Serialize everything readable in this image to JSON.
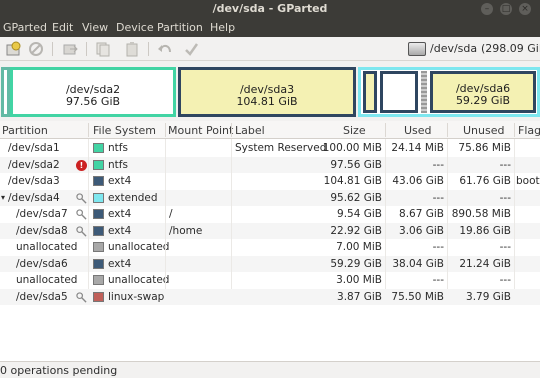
{
  "window": {
    "title": "/dev/sda - GParted"
  },
  "menu": [
    "GParted",
    "Edit",
    "View",
    "Device",
    "Partition",
    "Help"
  ],
  "toolbar": {
    "icons": [
      "new-icon",
      "delete-icon",
      "resize-icon",
      "copy-icon",
      "paste-icon",
      "undo-icon",
      "apply-icon"
    ]
  },
  "device": {
    "name": "/dev/sda",
    "size": "(298.09 GiB)"
  },
  "graph": {
    "sda2": {
      "name": "/dev/sda2",
      "size": "97.56 GiB"
    },
    "sda3": {
      "name": "/dev/sda3",
      "size": "104.81 GiB"
    },
    "sda6": {
      "name": "/dev/sda6",
      "size": "59.29 GiB"
    }
  },
  "columns": {
    "partition": "Partition",
    "filesystem": "File System",
    "mount": "Mount Point",
    "label": "Label",
    "size": "Size",
    "used": "Used",
    "unused": "Unused",
    "flags": "Flag"
  },
  "rows": [
    {
      "partition": "/dev/sda1",
      "fs": "ntfs",
      "fs_color": "#42d4a4",
      "mount": "",
      "label": "System Reserved",
      "size": "100.00 MiB",
      "used": "24.14 MiB",
      "unused": "75.86 MiB",
      "flags": "",
      "icon": ""
    },
    {
      "partition": "/dev/sda2",
      "fs": "ntfs",
      "fs_color": "#42d4a4",
      "mount": "",
      "label": "",
      "size": "97.56 GiB",
      "used": "---",
      "unused": "---",
      "flags": "",
      "icon": "warning"
    },
    {
      "partition": "/dev/sda3",
      "fs": "ext4",
      "fs_color": "#3d5a78",
      "mount": "",
      "label": "",
      "size": "104.81 GiB",
      "used": "43.06 GiB",
      "unused": "61.76 GiB",
      "flags": "boot",
      "icon": ""
    },
    {
      "partition": "/dev/sda4",
      "fs": "extended",
      "fs_color": "#7ee7ef",
      "mount": "",
      "label": "",
      "size": "95.62 GiB",
      "used": "---",
      "unused": "---",
      "flags": "",
      "icon": "key"
    },
    {
      "partition": "/dev/sda7",
      "fs": "ext4",
      "fs_color": "#3d5a78",
      "mount": "/",
      "label": "",
      "size": "9.54 GiB",
      "used": "8.67 GiB",
      "unused": "890.58 MiB",
      "flags": "",
      "icon": "key"
    },
    {
      "partition": "/dev/sda8",
      "fs": "ext4",
      "fs_color": "#3d5a78",
      "mount": "/home",
      "label": "",
      "size": "22.92 GiB",
      "used": "3.06 GiB",
      "unused": "19.86 GiB",
      "flags": "",
      "icon": "key"
    },
    {
      "partition": "unallocated",
      "fs": "unallocated",
      "fs_color": "#a8a8a8",
      "mount": "",
      "label": "",
      "size": "7.00 MiB",
      "used": "---",
      "unused": "---",
      "flags": "",
      "icon": ""
    },
    {
      "partition": "/dev/sda6",
      "fs": "ext4",
      "fs_color": "#3d5a78",
      "mount": "",
      "label": "",
      "size": "59.29 GiB",
      "used": "38.04 GiB",
      "unused": "21.24 GiB",
      "flags": "",
      "icon": ""
    },
    {
      "partition": "unallocated",
      "fs": "unallocated",
      "fs_color": "#a8a8a8",
      "mount": "",
      "label": "",
      "size": "3.00 MiB",
      "used": "---",
      "unused": "---",
      "flags": "",
      "icon": ""
    },
    {
      "partition": "/dev/sda5",
      "fs": "linux-swap",
      "fs_color": "#c0605a",
      "mount": "",
      "label": "",
      "size": "3.87 GiB",
      "used": "75.50 MiB",
      "unused": "3.79 GiB",
      "flags": "",
      "icon": "key"
    }
  ],
  "status": "0 operations pending"
}
